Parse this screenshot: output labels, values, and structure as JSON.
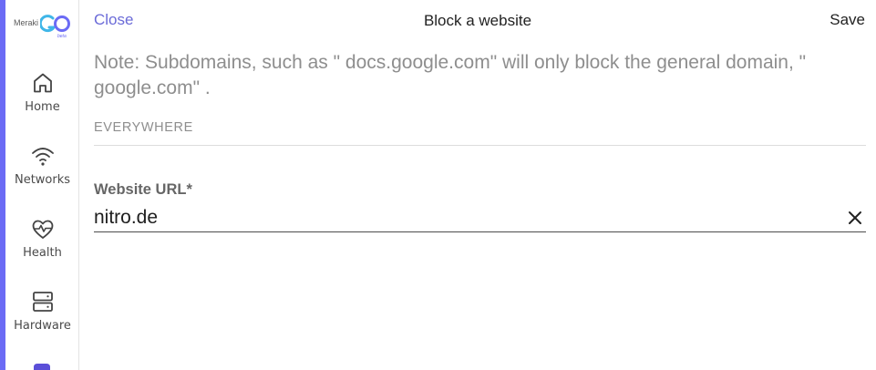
{
  "sidebar": {
    "logo": {
      "brand": "Meraki",
      "mark": "GO",
      "tag": "beta"
    },
    "items": [
      {
        "label": "Home",
        "icon": "home-icon"
      },
      {
        "label": "Networks",
        "icon": "wifi-icon"
      },
      {
        "label": "Health",
        "icon": "heart-pulse-icon"
      },
      {
        "label": "Hardware",
        "icon": "server-icon"
      }
    ]
  },
  "header": {
    "close_label": "Close",
    "title": "Block a website",
    "save_label": "Save"
  },
  "main": {
    "note": "Note: Subdomains, such as \" docs.google.com\"  will only block the general domain, \" google.com\" .",
    "section_label": "EVERYWHERE",
    "field": {
      "label": "Website URL*",
      "value": "nitro.de"
    }
  },
  "colors": {
    "accent": "#6b6bf5",
    "link": "#6b6bd8",
    "muted_text": "#8e8e8e"
  }
}
